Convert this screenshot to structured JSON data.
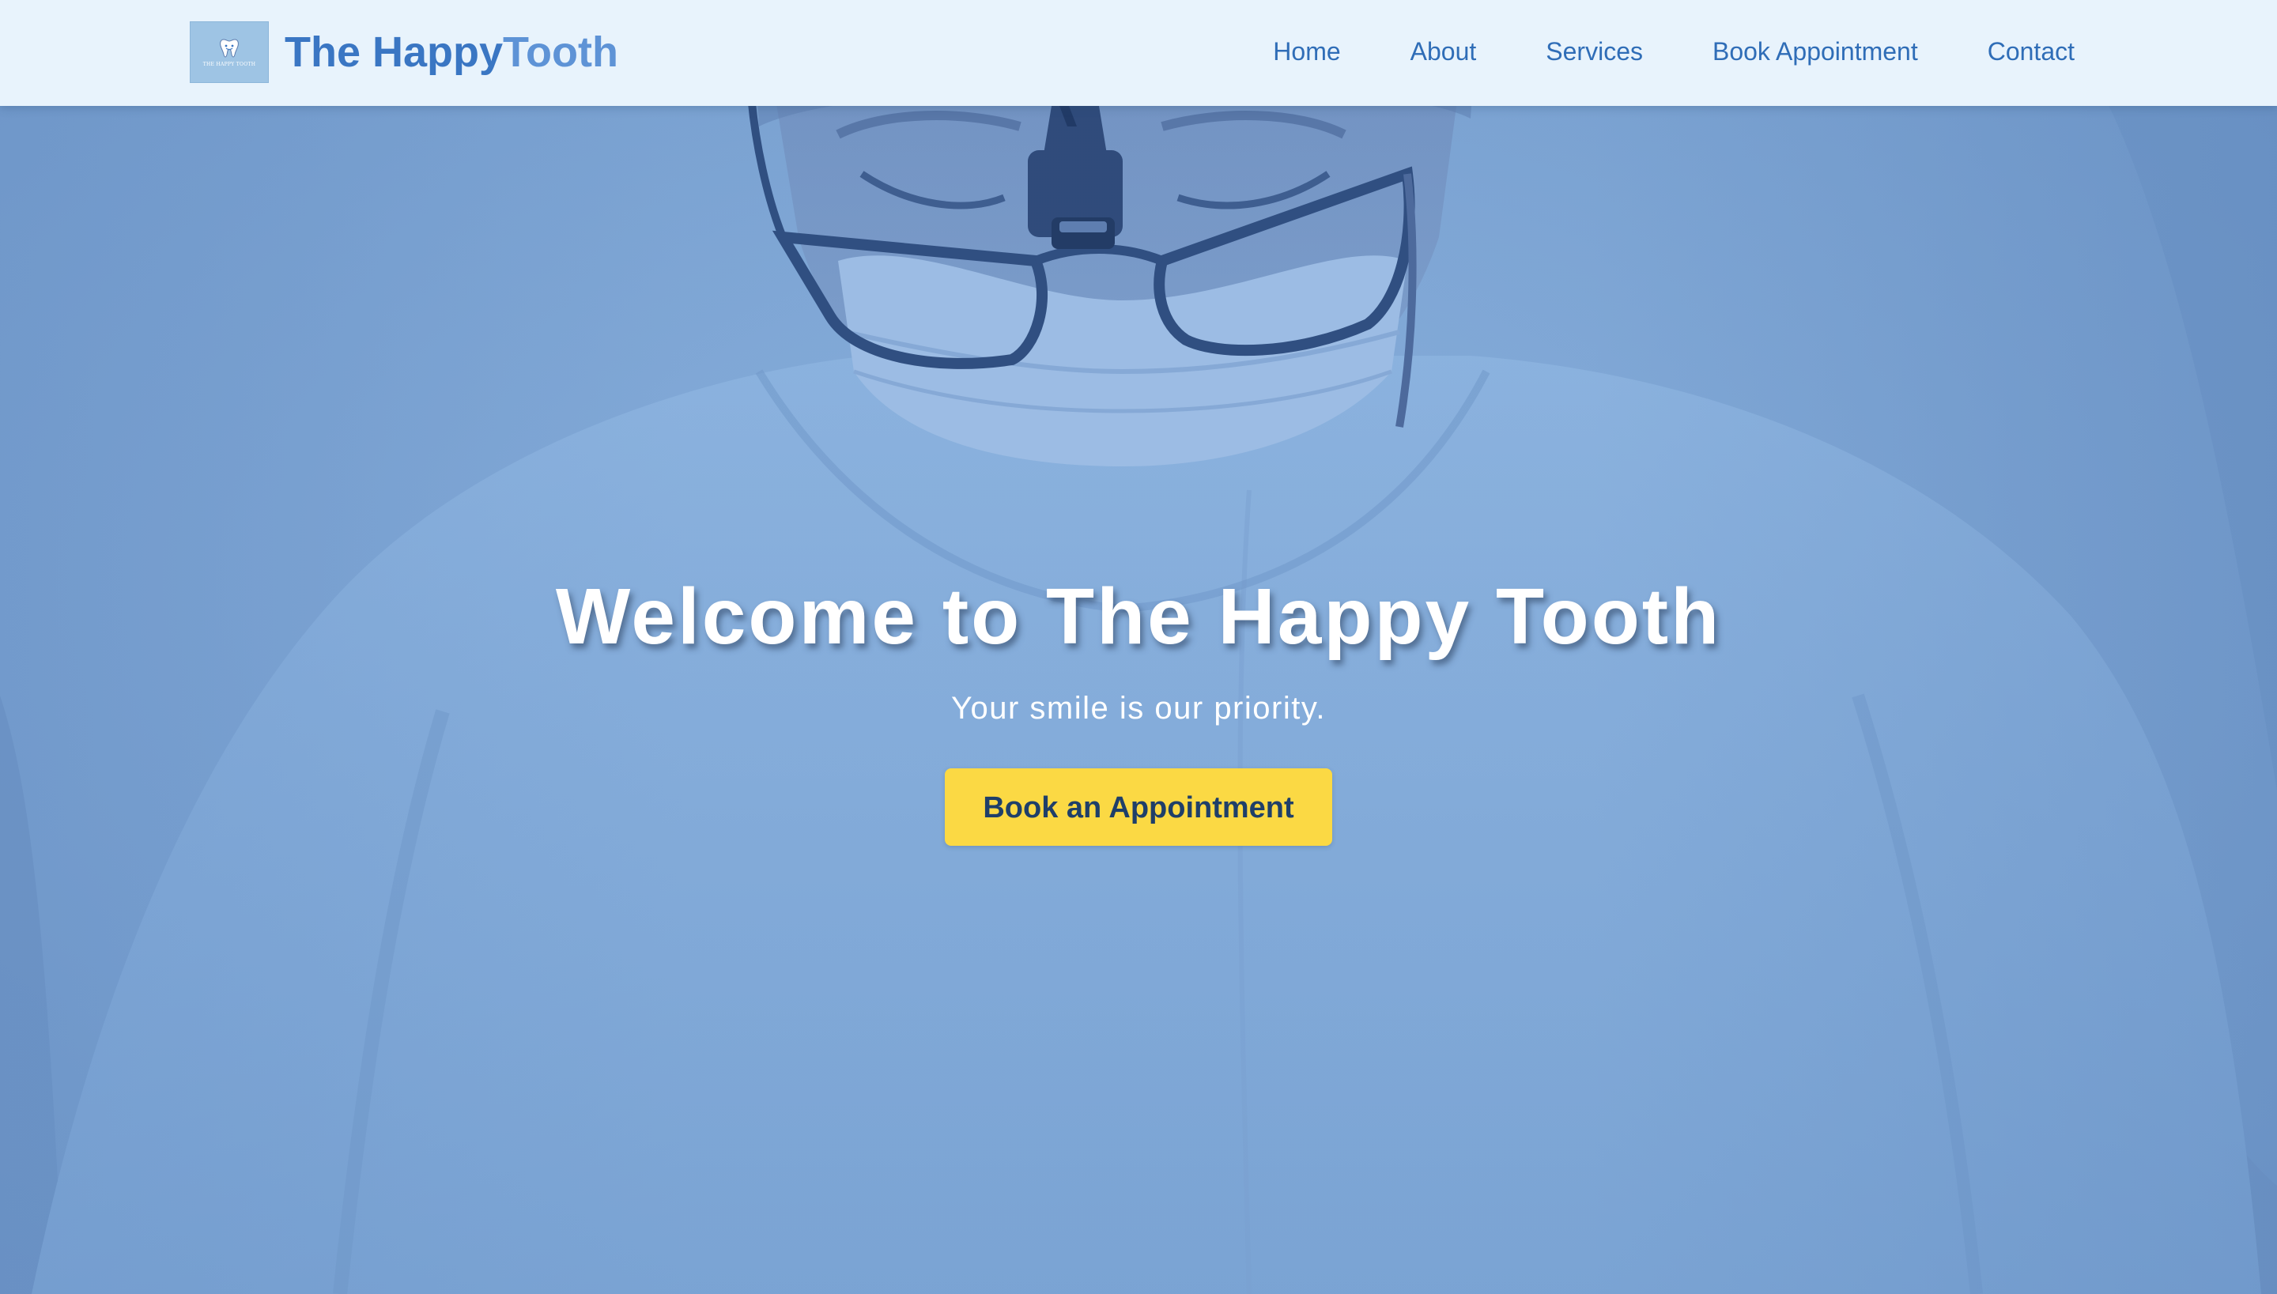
{
  "colors": {
    "navbar_bg": "#e8f3fc",
    "brand_primary": "#3a76c3",
    "brand_secondary": "#5e93d6",
    "nav_link": "#2f6db7",
    "hero_overlay": "#7aa2d2",
    "cta_bg": "#fbd944",
    "cta_text": "#1f3f69",
    "hero_text": "#ffffff"
  },
  "navbar": {
    "logo_icon": "tooth-icon",
    "logo_text": "THE HAPPY TOOTH",
    "brand_part1": "The Happy",
    "brand_part2": "Tooth",
    "links": [
      {
        "label": "Home"
      },
      {
        "label": "About"
      },
      {
        "label": "Services"
      },
      {
        "label": "Book Appointment"
      },
      {
        "label": "Contact"
      }
    ]
  },
  "hero": {
    "background_image": "dentist-with-magnifying-loupes",
    "title": "Welcome to The Happy Tooth",
    "subtitle": "Your smile is our priority.",
    "cta_label": "Book an Appointment"
  }
}
